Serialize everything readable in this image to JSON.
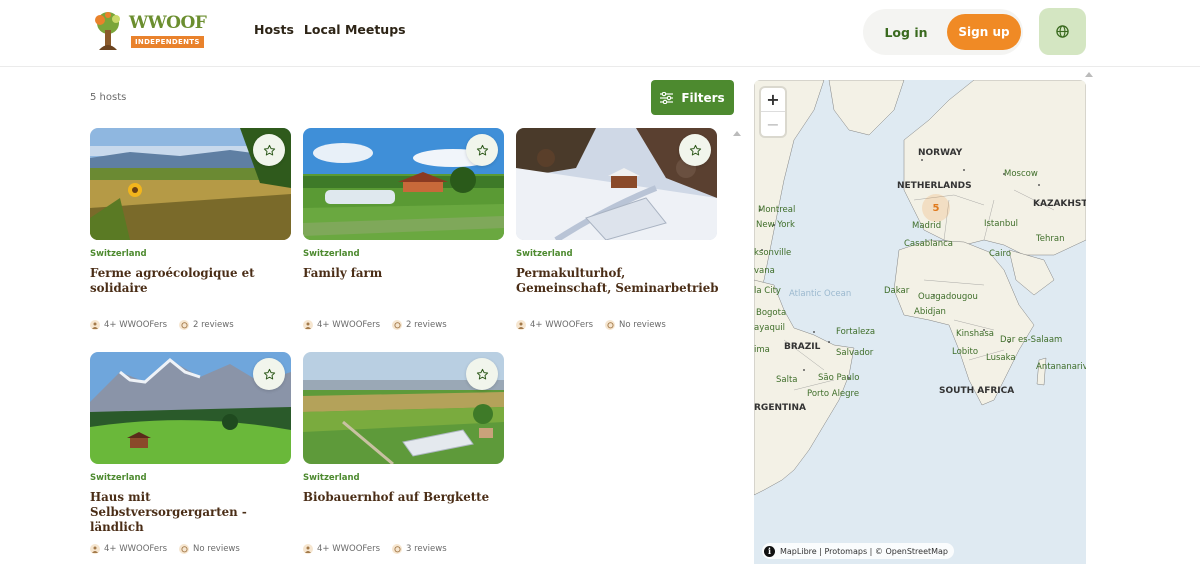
{
  "header": {
    "logo_text": "WWOOF",
    "logo_badge": "INDEPENDENTS",
    "nav": [
      "Hosts",
      "Local Meetups"
    ],
    "login_label": "Log in",
    "signup_label": "Sign up",
    "language_icon": "globe-icon"
  },
  "toolbar": {
    "host_count": "5 hosts",
    "filters_label": "Filters"
  },
  "hosts": [
    {
      "country": "Switzerland",
      "title": "Ferme agroécologique et solidaire",
      "wwoofers": "4+ WWOOFers",
      "reviews": "2 reviews"
    },
    {
      "country": "Switzerland",
      "title": "Family farm",
      "wwoofers": "4+ WWOOFers",
      "reviews": "2 reviews"
    },
    {
      "country": "Switzerland",
      "title": "Permakulturhof, Gemeinschaft, Seminarbetrieb",
      "wwoofers": "4+ WWOOFers",
      "reviews": "No reviews"
    },
    {
      "country": "Switzerland",
      "title": "Haus mit Selbstversorgergarten - ländlich",
      "wwoofers": "4+ WWOOFers",
      "reviews": "No reviews"
    },
    {
      "country": "Switzerland",
      "title": "Biobauernhof auf Bergkette",
      "wwoofers": "4+ WWOOFers",
      "reviews": "3 reviews"
    }
  ],
  "map": {
    "zoom_in": "+",
    "zoom_out": "−",
    "cluster_count": "5",
    "attribution": "MapLibre | Protomaps | © OpenStreetMap",
    "countries": [
      "NORWAY",
      "NETHERLANDS",
      "KAZAKHSTA",
      "BRAZIL",
      "SOUTH AFRICA",
      "RGENTINA"
    ],
    "cities": [
      "Moscow",
      "Montreal",
      "New York",
      "Madrid",
      "Istanbul",
      "Tehran",
      "Casablanca",
      "Cairo",
      "ksonville",
      "vana",
      "Dakar",
      "Ouagadougou",
      "la City",
      "Abidjan",
      "Bogota",
      "ayaquil",
      "Fortaleza",
      "Kinshasa",
      "Dar es-Salaam",
      "ima",
      "Salvador",
      "Lobito",
      "Lusaka",
      "Antananarivo",
      "Salta",
      "São Paulo",
      "Porto Alegre"
    ],
    "ocean": "Atlantic Ocean"
  }
}
